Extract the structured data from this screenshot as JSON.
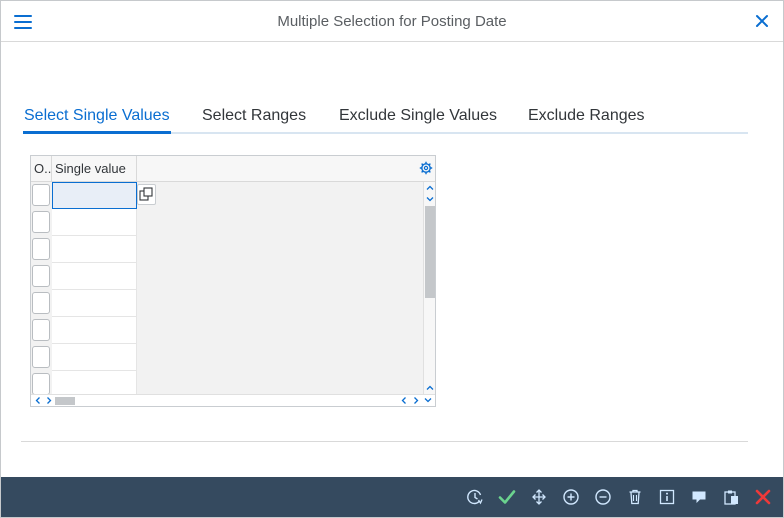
{
  "dialog": {
    "title": "Multiple Selection for Posting Date"
  },
  "tabs": [
    {
      "label": "Select Single Values",
      "active": true
    },
    {
      "label": "Select Ranges",
      "active": false
    },
    {
      "label": "Exclude Single Values",
      "active": false
    },
    {
      "label": "Exclude Ranges",
      "active": false
    }
  ],
  "table": {
    "columns": [
      {
        "label": "O.."
      },
      {
        "label": "Single value"
      }
    ],
    "rows": [
      "",
      "",
      "",
      "",
      "",
      "",
      "",
      ""
    ]
  },
  "footer": {
    "icons": [
      "clock-icon",
      "check-icon",
      "move-icon",
      "plus-circle-icon",
      "minus-circle-icon",
      "trash-icon",
      "info-icon",
      "comment-icon",
      "clipboard-icon",
      "cancel-icon"
    ]
  },
  "colors": {
    "accent": "#0a6ed1",
    "footer_bg": "#354a5f",
    "confirm": "#6bd38e",
    "cancel": "#ee3939"
  }
}
